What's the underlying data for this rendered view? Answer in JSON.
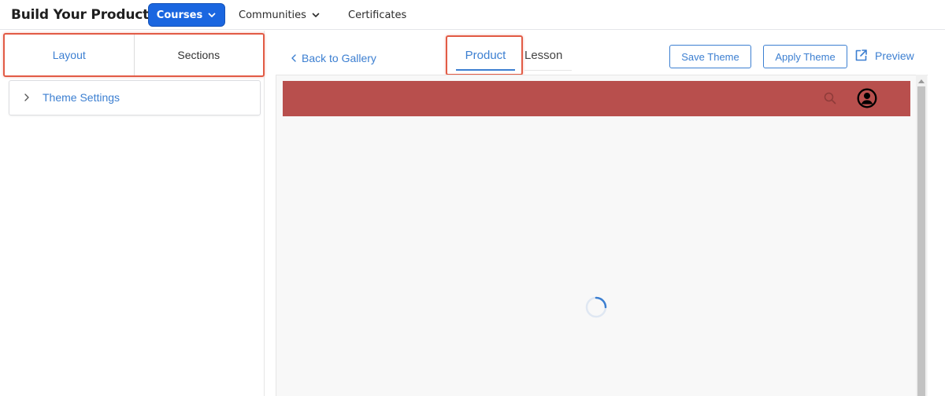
{
  "app": {
    "title": "Build Your Product"
  },
  "nav": {
    "courses_label": "Courses",
    "communities_label": "Communities",
    "certificates_label": "Certificates"
  },
  "sidebar": {
    "tabs": [
      {
        "label": "Layout",
        "active": true
      },
      {
        "label": "Sections",
        "active": false
      }
    ],
    "theme_settings_label": "Theme Settings"
  },
  "editor": {
    "back_label": "Back to Gallery",
    "tabs": [
      {
        "label": "Product",
        "active": true
      },
      {
        "label": "Lesson",
        "active": false
      }
    ],
    "save_theme_label": "Save Theme",
    "apply_theme_label": "Apply Theme",
    "preview_label": "Preview"
  },
  "preview": {
    "header_color": "#b84f4d",
    "icons": [
      "search-icon",
      "user-account-icon"
    ],
    "loading": true
  },
  "colors": {
    "accent": "#1a66e0",
    "link": "#3c7fd1",
    "highlight_border": "#e25b45"
  }
}
